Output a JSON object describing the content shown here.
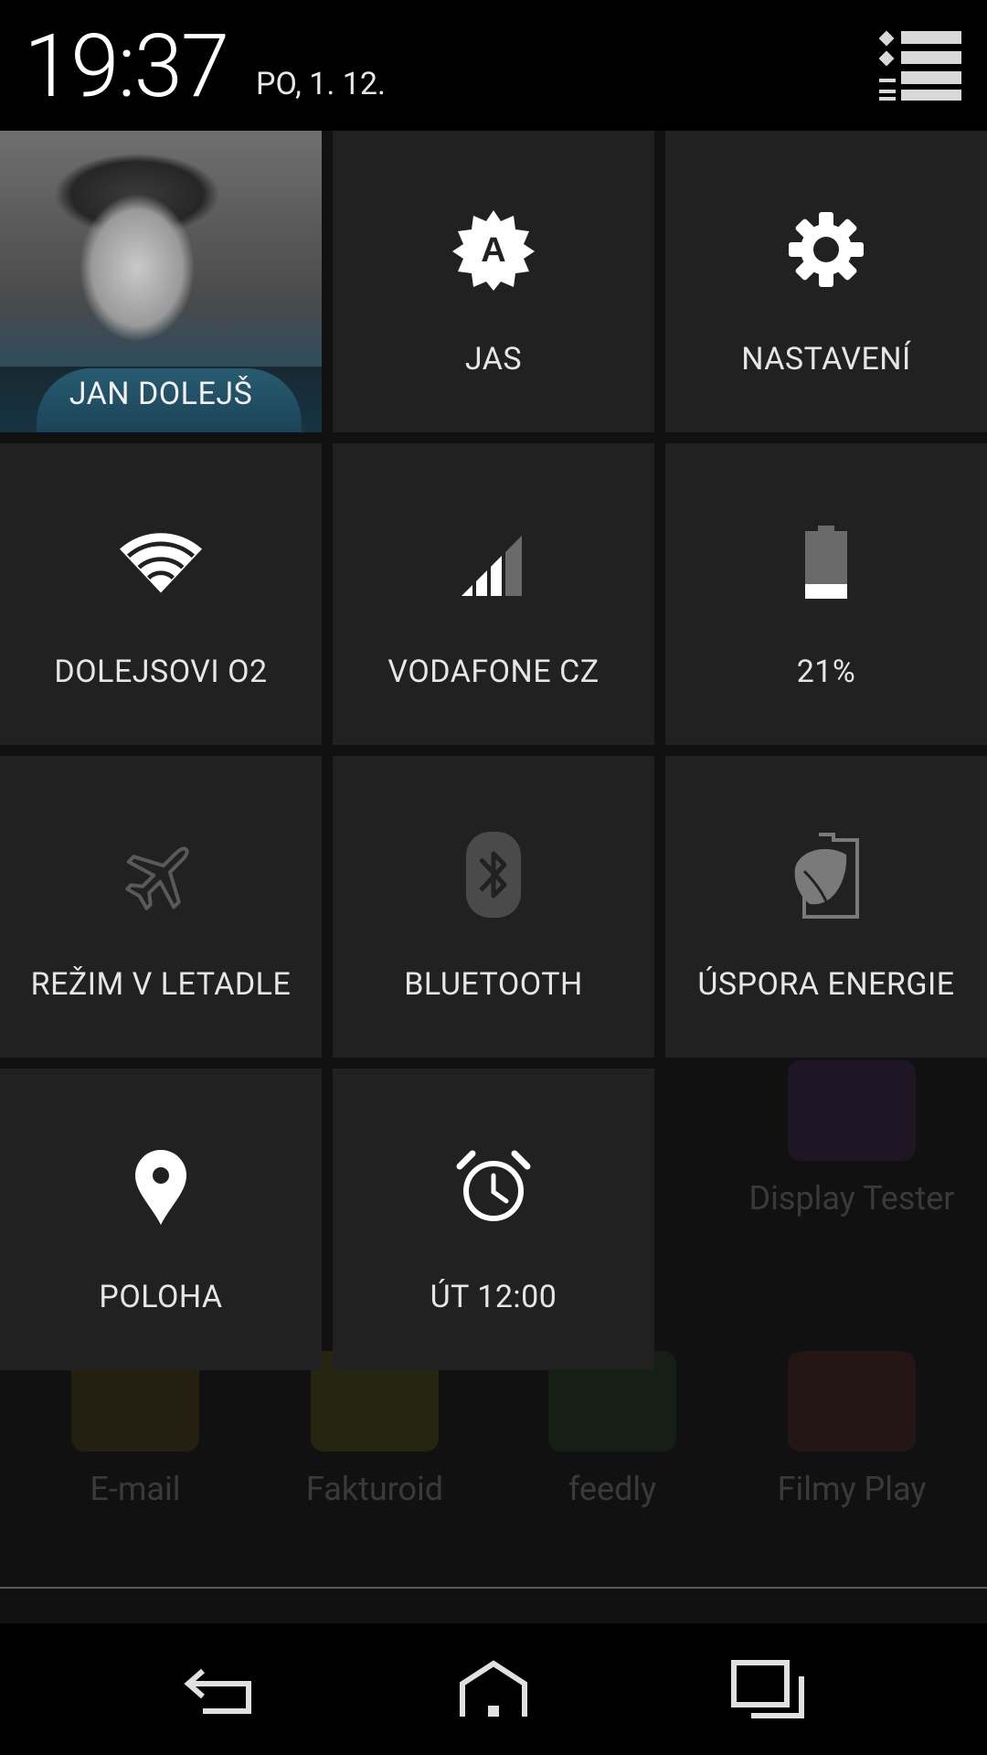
{
  "status_header": {
    "time": "19:37",
    "date": "PO, 1. 12.",
    "menu_icon": "list-icon"
  },
  "tiles": {
    "user": {
      "label": "JAN DOLEJŠ",
      "icon": "avatar-photo"
    },
    "brightness": {
      "label": "JAS",
      "icon": "brightness-auto-icon"
    },
    "settings": {
      "label": "NASTAVENÍ",
      "icon": "gear-icon"
    },
    "wifi": {
      "label": "DOLEJSOVI O2",
      "icon": "wifi-icon"
    },
    "mobile": {
      "label": "VODAFONE CZ",
      "icon": "signal-icon"
    },
    "battery": {
      "label": "21%",
      "icon": "battery-icon",
      "level": 0.21
    },
    "airplane": {
      "label": "REŽIM V LETADLE",
      "icon": "airplane-icon",
      "enabled": false
    },
    "bluetooth": {
      "label": "BLUETOOTH",
      "icon": "bluetooth-icon",
      "enabled": false
    },
    "power_saver": {
      "label": "ÚSPORA ENERGIE",
      "icon": "leaf-battery-icon",
      "enabled": false
    },
    "location": {
      "label": "POLOHA",
      "icon": "location-pin-icon"
    },
    "alarm": {
      "label": "ÚT 12:00",
      "icon": "alarm-clock-icon"
    }
  },
  "background_apps": [
    "Display Tester",
    "E-mail",
    "Fakturoid",
    "feedly",
    "Filmy Play"
  ],
  "navbar": {
    "back": "back-icon",
    "home": "home-icon",
    "recents": "recents-icon"
  },
  "colors": {
    "tile_bg": "#212121",
    "header_bg": "#000000",
    "text": "#e6e6e6",
    "disabled_icon": "#555555"
  }
}
